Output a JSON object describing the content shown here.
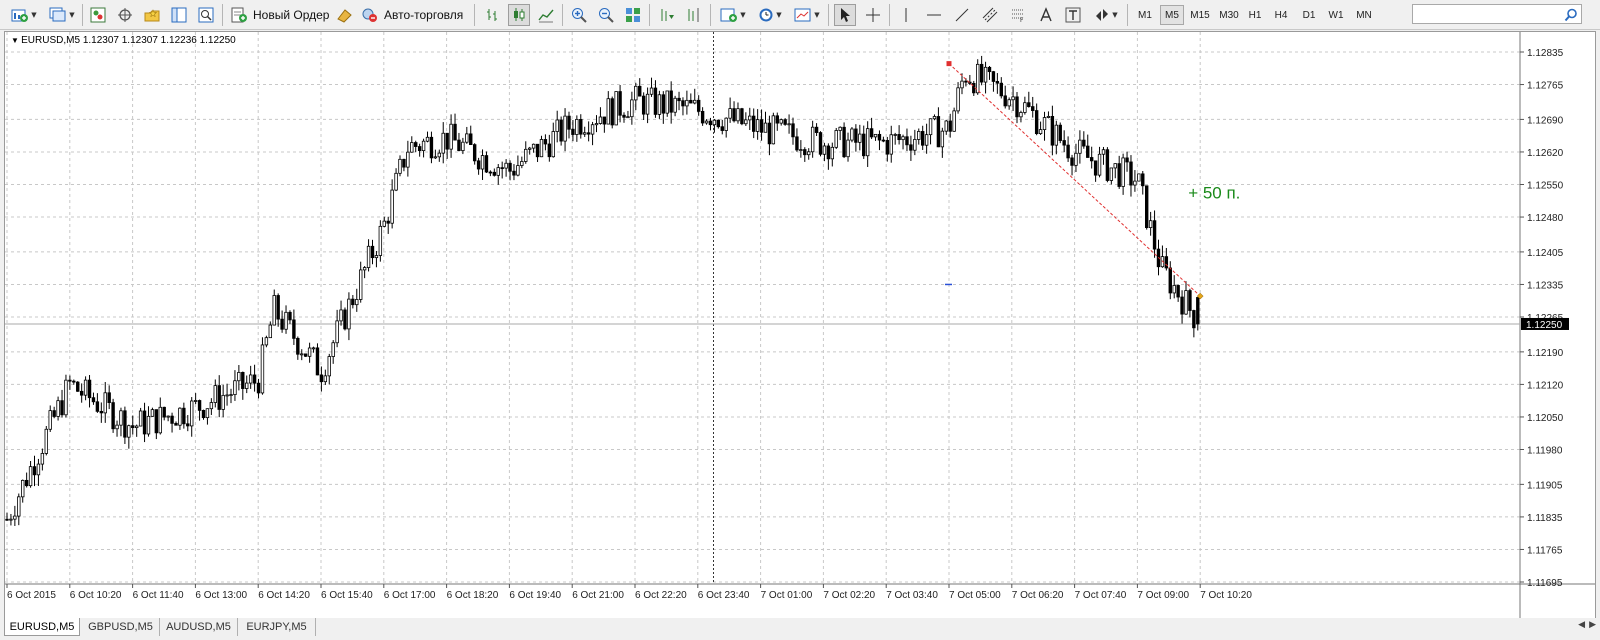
{
  "toolbar": {
    "new_order_label": "Новый Ордер",
    "auto_trading_label": "Авто-торговля",
    "timeframes": [
      "M1",
      "M5",
      "M15",
      "M30",
      "H1",
      "H4",
      "D1",
      "W1",
      "MN"
    ],
    "active_timeframe": "M5",
    "search_value": ""
  },
  "chart": {
    "header": "EURUSD,M5  1.12307 1.12307 1.12236 1.12250",
    "annotation": "+ 50 п.",
    "annotation_color": "#1a8a1a",
    "price_labels": [
      "1.12835",
      "1.12765",
      "1.12690",
      "1.12620",
      "1.12550",
      "1.12480",
      "1.12405",
      "1.12335",
      "1.12265",
      "1.12190",
      "1.12120",
      "1.12050",
      "1.11980",
      "1.11905",
      "1.11835",
      "1.11765",
      "1.11695"
    ],
    "current_price": "1.12250",
    "time_labels": [
      "6 Oct 2015",
      "6 Oct 10:20",
      "6 Oct 11:40",
      "6 Oct 13:00",
      "6 Oct 14:20",
      "6 Oct 15:40",
      "6 Oct 17:00",
      "6 Oct 18:20",
      "6 Oct 19:40",
      "6 Oct 21:00",
      "6 Oct 22:20",
      "6 Oct 23:40",
      "7 Oct 01:00",
      "7 Oct 02:20",
      "7 Oct 03:40",
      "7 Oct 05:00",
      "7 Oct 06:20",
      "7 Oct 07:40",
      "7 Oct 09:00",
      "7 Oct 10:20"
    ],
    "trade_line_color": "#e03030"
  },
  "tabs": [
    {
      "label": "EURUSD,M5",
      "active": true
    },
    {
      "label": "GBPUSD,M5",
      "active": false
    },
    {
      "label": "AUDUSD,M5",
      "active": false
    },
    {
      "label": "EURJPY,M5",
      "active": false
    }
  ],
  "chart_data": {
    "type": "candlestick",
    "symbol": "EURUSD",
    "timeframe": "M5",
    "ylim": [
      1.11695,
      1.12835
    ],
    "current_price": 1.1225,
    "last_bar": {
      "open": 1.12307,
      "high": 1.12307,
      "low": 1.12236,
      "close": 1.1225
    },
    "grid": true,
    "price_path": [
      {
        "time": "6 Oct 2015",
        "price": 1.1183
      },
      {
        "time": "6 Oct 10:20",
        "price": 1.1212
      },
      {
        "time": "6 Oct 11:40",
        "price": 1.1203
      },
      {
        "time": "6 Oct 13:00",
        "price": 1.1207
      },
      {
        "time": "6 Oct 14:20",
        "price": 1.1213
      },
      {
        "time": "6 Oct 14:40",
        "price": 1.1228
      },
      {
        "time": "6 Oct 15:40",
        "price": 1.1215
      },
      {
        "time": "6 Oct 17:00",
        "price": 1.1246
      },
      {
        "time": "6 Oct 17:30",
        "price": 1.1263
      },
      {
        "time": "6 Oct 18:20",
        "price": 1.1265
      },
      {
        "time": "6 Oct 19:40",
        "price": 1.1258
      },
      {
        "time": "6 Oct 21:00",
        "price": 1.1268
      },
      {
        "time": "6 Oct 22:20",
        "price": 1.1273
      },
      {
        "time": "6 Oct 23:40",
        "price": 1.1271
      },
      {
        "time": "7 Oct 01:00",
        "price": 1.1267
      },
      {
        "time": "7 Oct 02:20",
        "price": 1.1264
      },
      {
        "time": "7 Oct 03:40",
        "price": 1.1264
      },
      {
        "time": "7 Oct 05:00",
        "price": 1.1267
      },
      {
        "time": "7 Oct 05:20",
        "price": 1.1279
      },
      {
        "time": "7 Oct 06:20",
        "price": 1.1274
      },
      {
        "time": "7 Oct 07:40",
        "price": 1.1262
      },
      {
        "time": "7 Oct 09:00",
        "price": 1.1256
      },
      {
        "time": "7 Oct 09:30",
        "price": 1.1237
      },
      {
        "time": "7 Oct 10:20",
        "price": 1.1225
      }
    ],
    "trade_line": {
      "from": {
        "time": "7 Oct 05:00",
        "price": 1.1281
      },
      "to": {
        "time": "7 Oct 10:20",
        "price": 1.1231
      }
    }
  }
}
